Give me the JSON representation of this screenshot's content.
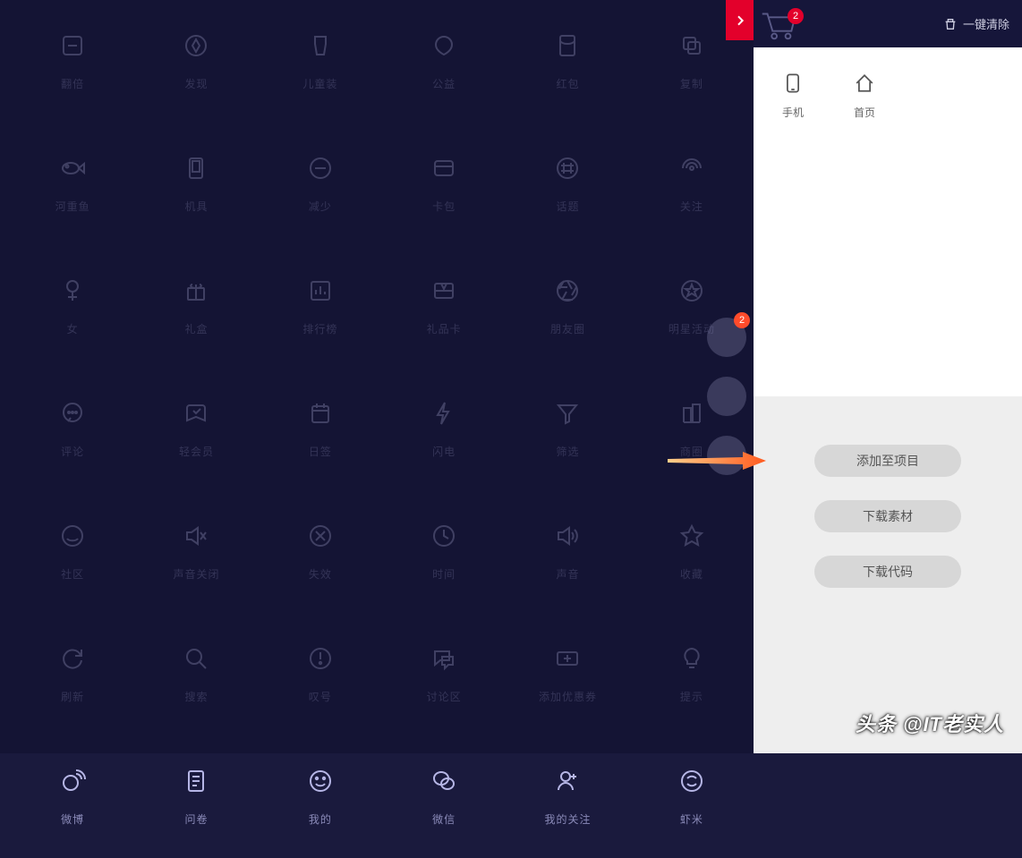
{
  "grid": {
    "items": [
      {
        "name": "fanbei",
        "label": "翻倍",
        "icon": "flip"
      },
      {
        "name": "faxian",
        "label": "发现",
        "icon": "discover"
      },
      {
        "name": "ertongzhuang",
        "label": "儿童装",
        "icon": "kids"
      },
      {
        "name": "gongyi",
        "label": "公益",
        "icon": "charity"
      },
      {
        "name": "hongbao",
        "label": "红包",
        "icon": "redpacket"
      },
      {
        "name": "fuzhi",
        "label": "复制",
        "icon": "copy"
      },
      {
        "name": "hechongyu",
        "label": "河重鱼",
        "icon": "fish"
      },
      {
        "name": "jiju",
        "label": "机具",
        "icon": "device"
      },
      {
        "name": "jianshao",
        "label": "减少",
        "icon": "minus"
      },
      {
        "name": "kabao",
        "label": "卡包",
        "icon": "wallet"
      },
      {
        "name": "huati",
        "label": "话题",
        "icon": "hash"
      },
      {
        "name": "guanzhu",
        "label": "关注",
        "icon": "signal"
      },
      {
        "name": "nv",
        "label": "女",
        "icon": "female"
      },
      {
        "name": "lihe",
        "label": "礼盒",
        "icon": "gift"
      },
      {
        "name": "paihangbang",
        "label": "排行榜",
        "icon": "chart"
      },
      {
        "name": "lipinka",
        "label": "礼品卡",
        "icon": "giftcard"
      },
      {
        "name": "pengyouquan",
        "label": "朋友圈",
        "icon": "aperture"
      },
      {
        "name": "mingxinghuodong",
        "label": "明星活动",
        "icon": "starbadge"
      },
      {
        "name": "pinglun",
        "label": "评论",
        "icon": "comment"
      },
      {
        "name": "qinghuiyuan",
        "label": "轻会员",
        "icon": "member"
      },
      {
        "name": "riqian",
        "label": "日签",
        "icon": "calendar"
      },
      {
        "name": "shandian",
        "label": "闪电",
        "icon": "bolt"
      },
      {
        "name": "shaixuan",
        "label": "筛选",
        "icon": "filter"
      },
      {
        "name": "shangquan",
        "label": "商圈",
        "icon": "buildings"
      },
      {
        "name": "shequ",
        "label": "社区",
        "icon": "community"
      },
      {
        "name": "shengyinguanbi",
        "label": "声音关闭",
        "icon": "mute"
      },
      {
        "name": "shixiao",
        "label": "失效",
        "icon": "xcircle"
      },
      {
        "name": "shijian",
        "label": "时间",
        "icon": "clock"
      },
      {
        "name": "shengyin",
        "label": "声音",
        "icon": "sound"
      },
      {
        "name": "shoucang",
        "label": "收藏",
        "icon": "star"
      },
      {
        "name": "shuaxin",
        "label": "刷新",
        "icon": "refresh"
      },
      {
        "name": "sousuo",
        "label": "搜索",
        "icon": "search"
      },
      {
        "name": "tanhao",
        "label": "叹号",
        "icon": "exclaim"
      },
      {
        "name": "taolunqu",
        "label": "讨论区",
        "icon": "discuss"
      },
      {
        "name": "tianjiayouhuiquan",
        "label": "添加优惠券",
        "icon": "addcoupon"
      },
      {
        "name": "tishi",
        "label": "提示",
        "icon": "bulb"
      },
      {
        "name": "weibo",
        "label": "微博",
        "icon": "weibo"
      },
      {
        "name": "wenjuan",
        "label": "问卷",
        "icon": "survey"
      },
      {
        "name": "wode",
        "label": "我的",
        "icon": "smile"
      },
      {
        "name": "weixin",
        "label": "微信",
        "icon": "wechat"
      },
      {
        "name": "wodeguanzhu",
        "label": "我的关注",
        "icon": "userplus"
      },
      {
        "name": "xiami",
        "label": "虾米",
        "icon": "xiami"
      }
    ]
  },
  "floating": {
    "badge": "2"
  },
  "sidebar": {
    "cart_badge": "2",
    "clear_label": "一键清除",
    "cart_items": [
      {
        "name": "phone",
        "label": "手机",
        "icon": "phone"
      },
      {
        "name": "home",
        "label": "首页",
        "icon": "home"
      }
    ],
    "actions": {
      "add_project": "添加至项目",
      "download_asset": "下载素材",
      "download_code": "下载代码"
    }
  },
  "watermark": "头条 @IT老实人"
}
